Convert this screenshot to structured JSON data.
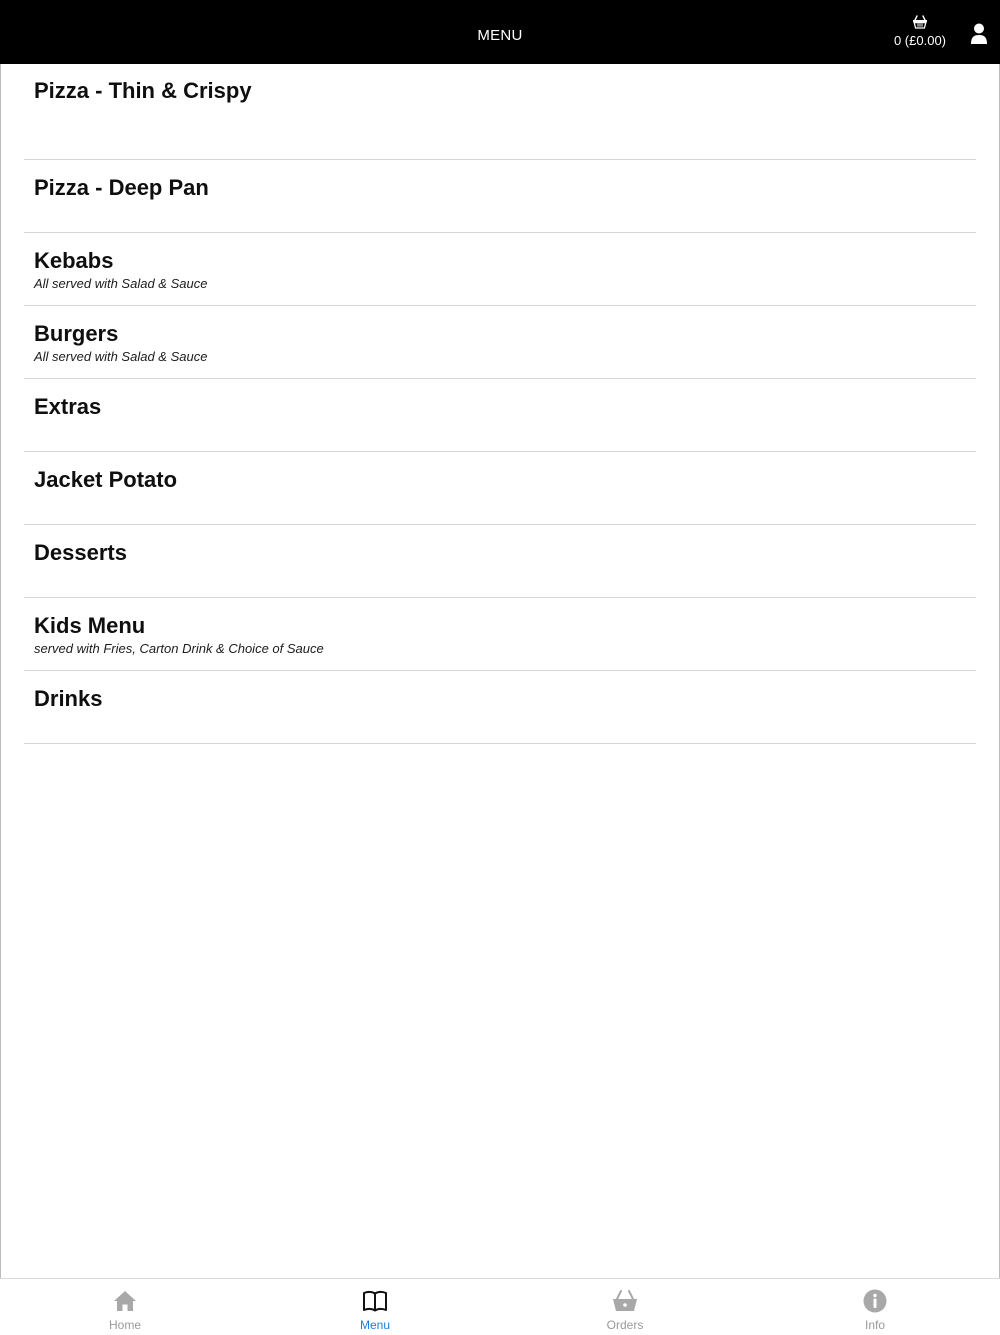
{
  "header": {
    "title": "MENU",
    "cart_label": "0 (£0.00)",
    "cart_icon": "basket-icon",
    "user_icon": "user-icon"
  },
  "menu": {
    "items": [
      {
        "title": "Pizza - Thin & Crispy",
        "subtitle": ""
      },
      {
        "title": "Pizza - Deep Pan",
        "subtitle": ""
      },
      {
        "title": "Kebabs",
        "subtitle": "All served with Salad & Sauce"
      },
      {
        "title": "Burgers",
        "subtitle": "All served with Salad & Sauce"
      },
      {
        "title": "Extras",
        "subtitle": ""
      },
      {
        "title": "Jacket Potato",
        "subtitle": ""
      },
      {
        "title": "Desserts",
        "subtitle": ""
      },
      {
        "title": "Kids Menu",
        "subtitle": "served with Fries, Carton Drink & Choice of Sauce"
      },
      {
        "title": "Drinks",
        "subtitle": ""
      }
    ]
  },
  "tabbar": {
    "tabs": [
      {
        "label": "Home",
        "icon": "home-icon"
      },
      {
        "label": "Menu",
        "icon": "book-icon"
      },
      {
        "label": "Orders",
        "icon": "basket-icon"
      },
      {
        "label": "Info",
        "icon": "info-icon"
      }
    ],
    "active": "Menu",
    "active_color": "#1a7fd6",
    "inactive_color": "#9a9a9a"
  },
  "colors": {
    "header_bg": "#000000",
    "header_text": "#ffffff",
    "divider": "#d6d6d6"
  }
}
